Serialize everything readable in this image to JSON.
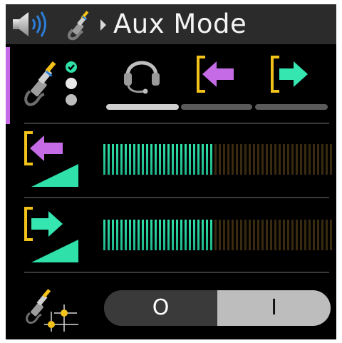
{
  "header": {
    "title": "Aux Mode",
    "icons": [
      "speaker-volume-icon",
      "audio-jack-icon",
      "caret-right-icon"
    ]
  },
  "routing": {
    "icons": [
      "headset-icon",
      "aux-input-icon",
      "aux-output-icon"
    ],
    "selected_index": 0
  },
  "meters": [
    {
      "name": "aux-input-level",
      "icon": "aux-input-level-icon",
      "level": 0.49
    },
    {
      "name": "aux-output-level",
      "icon": "aux-output-level-icon",
      "level": 0.49
    }
  ],
  "switch": {
    "icon": "jack-crosshair-icon",
    "off_label": "O",
    "on_label": "I",
    "state": "on"
  },
  "colors": {
    "accent": "#c56be6",
    "meter_active": "#2fe0a8",
    "meter_inactive": "#3a2a10",
    "bracket": "#f2c21a",
    "arrow_in": "#c56be6",
    "arrow_out": "#35e6b0",
    "check": "#2fe0a8"
  }
}
